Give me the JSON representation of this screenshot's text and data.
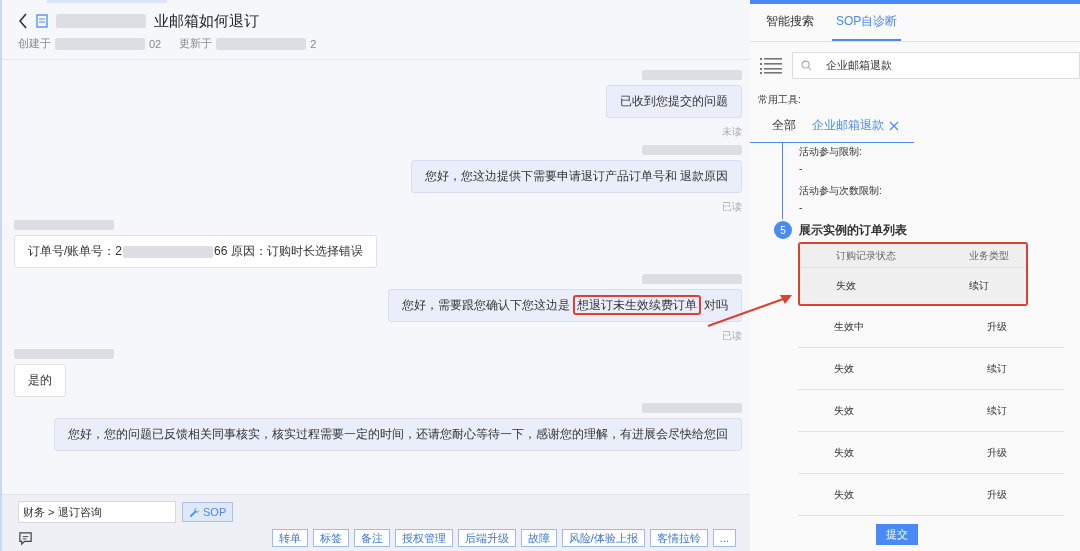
{
  "ticket": {
    "title": "业邮箱如何退订",
    "created_label": "创建于",
    "created_tail": "02",
    "updated_label": "更新于",
    "updated_tail": "2"
  },
  "messages": [
    {
      "kind": "outgoing",
      "segments": [
        {
          "kind": "plain",
          "text": "已收到您提交的问题"
        }
      ],
      "receipt": "未读"
    },
    {
      "kind": "outgoing",
      "segments": [
        {
          "kind": "plain",
          "text": "您好，您这边提供下需要申请退订产品订单号和 退款原因"
        }
      ],
      "receipt": "已读"
    },
    {
      "kind": "incoming",
      "segments": [
        {
          "kind": "plain",
          "text": "订单号/账单号：2"
        },
        {
          "kind": "redacted"
        },
        {
          "kind": "plain",
          "text": "66 原因：订购时长选择错误"
        }
      ]
    },
    {
      "kind": "outgoing",
      "segments": [
        {
          "kind": "plain",
          "text": "您好，需要跟您确认下您这边是"
        },
        {
          "kind": "highlight",
          "text": "想退订未生效续费订单"
        },
        {
          "kind": "plain",
          "text": "对吗"
        }
      ],
      "receipt": "已读"
    },
    {
      "kind": "incoming",
      "segments": [
        {
          "kind": "plain",
          "text": "是的"
        }
      ]
    },
    {
      "kind": "outgoing",
      "segments": [
        {
          "kind": "plain",
          "text": "您好，您的问题已反馈相关同事核实，核实过程需要一定的时间，还请您耐心等待一下，感谢您的理解，有进展会尽快给您回"
        }
      ]
    }
  ],
  "footer": {
    "category": "财务 > 退订咨询",
    "sop_button": "SOP",
    "actions": [
      "转单",
      "标签",
      "备注",
      "授权管理",
      "后端升级",
      "故障",
      "风险/体验上报",
      "客情拉铃",
      "..."
    ]
  },
  "side_panel": {
    "tabs": [
      {
        "label": "智能搜索",
        "selected": false
      },
      {
        "label": "SOP自诊断",
        "selected": true
      }
    ],
    "search": {
      "value": "企业邮箱退款"
    },
    "tools_label": "常用工具:",
    "tool_tabs": [
      {
        "label": "全部",
        "selected": false,
        "closable": false
      },
      {
        "label": "企业邮箱退款",
        "selected": true,
        "closable": true
      }
    ],
    "fields": [
      {
        "label": "活动参与限制:",
        "value": "-"
      },
      {
        "label": "活动参与次数限制:",
        "value": "-"
      }
    ],
    "step": {
      "number": "5",
      "title": "展示实例的订单列表"
    },
    "table": {
      "columns": [
        "订购记录状态",
        "业务类型"
      ],
      "rows": [
        {
          "cells": [
            "失效",
            "续订"
          ],
          "highlighted": true
        },
        {
          "cells": [
            "生效中",
            "升级"
          ],
          "highlighted": false
        },
        {
          "cells": [
            "失效",
            "续订"
          ],
          "highlighted": false
        },
        {
          "cells": [
            "失效",
            "续订"
          ],
          "highlighted": false
        },
        {
          "cells": [
            "失效",
            "升级"
          ],
          "highlighted": false
        },
        {
          "cells": [
            "失效",
            "升级"
          ],
          "highlighted": false
        }
      ]
    },
    "submit_button": "提交"
  }
}
